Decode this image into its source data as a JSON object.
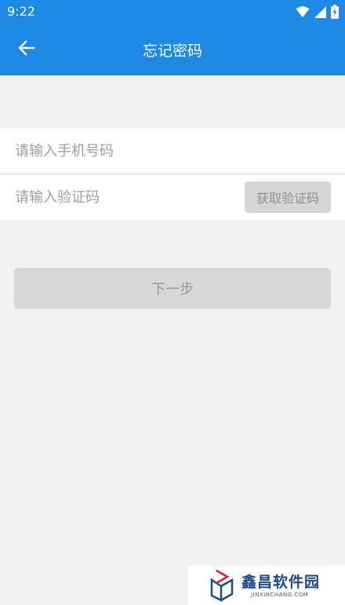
{
  "status_bar": {
    "time": "9:22",
    "icons": [
      "wifi-icon",
      "cellular-signal-icon",
      "battery-charging-icon"
    ]
  },
  "header": {
    "title": "忘记密码",
    "back_icon": "arrow-left-icon",
    "background": "#1e88e5"
  },
  "form": {
    "phone": {
      "placeholder": "请输入手机号码",
      "value": ""
    },
    "code": {
      "placeholder": "请输入验证码",
      "value": ""
    },
    "get_code_label": "获取验证码"
  },
  "next_label": "下一步",
  "watermark": {
    "name": "鑫昌软件园",
    "url": "JINXINCHANG.COM"
  }
}
